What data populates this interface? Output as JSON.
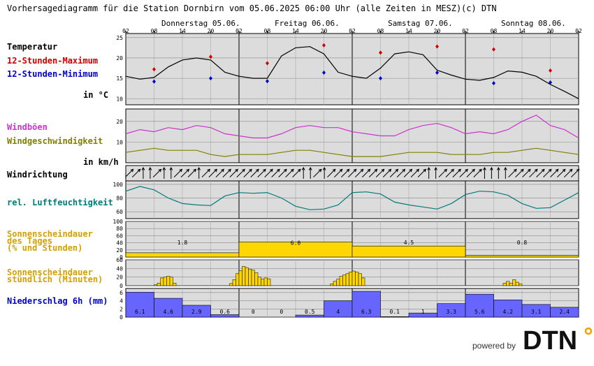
{
  "header": {
    "title": "Vorhersagediagramm für die Station Dornbirn vom 05.06.2025 06:00 Uhr (alle Zeiten in MESZ)",
    "copyright": "(c) DTN"
  },
  "days": [
    "Donnerstag 05.06.",
    "Freitag 06.06.",
    "Samstag 07.06.",
    "Sonntag 08.06."
  ],
  "hour_ticks": [
    "02",
    "08",
    "14",
    "20",
    "02",
    "08",
    "14",
    "20",
    "02",
    "08",
    "14",
    "20",
    "02",
    "08",
    "14",
    "20",
    "02"
  ],
  "labels": {
    "temperatur": "Temperatur",
    "max": "12-Stunden-Maximum",
    "min": "12-Stunden-Minimum",
    "temp_unit": "in °C",
    "windboeen": "Windböen",
    "windgeschw": "Windgeschwindigkeit",
    "wind_unit": "in km/h",
    "windrichtung": "Windrichtung",
    "feuchte": "rel. Luftfeuchtigkeit",
    "sonne_tag_1": "Sonnenscheindauer",
    "sonne_tag_2": "des Tages",
    "sonne_tag_3": "(% und Stunden)",
    "sonne_std_1": "Sonnenscheindauer",
    "sonne_std_2": "stündlich (Minuten)",
    "niederschlag": "Niederschlag 6h (mm)"
  },
  "footer": {
    "powered_by": "powered by",
    "logo_text": "DTN"
  },
  "colors": {
    "panel_bg": "#dcdcdc",
    "max": "#cc0000",
    "min": "#0000cc",
    "gusts": "#cc33cc",
    "wind": "#808000",
    "humidity": "#007b7b",
    "sun_label": "#d4a000",
    "sun_fill": "#ffd700",
    "rain_label": "#0000cc",
    "rain_fill": "#6666ff"
  },
  "chart_data": [
    {
      "panel": "temperature",
      "type": "line",
      "yticks": [
        10,
        15,
        20,
        25
      ],
      "ylim": [
        8.5,
        26
      ],
      "hours_from_start": [
        0,
        3,
        6,
        9,
        12,
        15,
        18,
        21,
        24,
        27,
        30,
        33,
        36,
        39,
        42,
        45,
        48,
        51,
        54,
        57,
        60,
        63,
        66,
        69,
        72,
        75,
        78,
        81,
        84,
        87,
        90,
        93,
        96
      ],
      "temperature": [
        15.5,
        14.8,
        15.2,
        17.8,
        19.5,
        20.0,
        19.5,
        16.5,
        15.5,
        15.0,
        15.0,
        20.5,
        22.5,
        22.8,
        21.0,
        16.5,
        15.5,
        15.0,
        17.5,
        21.0,
        21.5,
        20.8,
        17.0,
        15.8,
        14.8,
        14.5,
        15.2,
        16.8,
        16.5,
        15.5,
        13.5,
        11.8,
        10.0
      ],
      "max_points": [
        {
          "hour": 6,
          "value": 17.2
        },
        {
          "hour": 18,
          "value": 20.3
        },
        {
          "hour": 30,
          "value": 18.7
        },
        {
          "hour": 42,
          "value": 23.1
        },
        {
          "hour": 54,
          "value": 21.3
        },
        {
          "hour": 66,
          "value": 22.8
        },
        {
          "hour": 78,
          "value": 22.1
        },
        {
          "hour": 90,
          "value": 16.9
        }
      ],
      "min_points": [
        {
          "hour": 6,
          "value": 14.2
        },
        {
          "hour": 18,
          "value": 15.0
        },
        {
          "hour": 30,
          "value": 14.3
        },
        {
          "hour": 42,
          "value": 16.4
        },
        {
          "hour": 54,
          "value": 15.0
        },
        {
          "hour": 66,
          "value": 16.4
        },
        {
          "hour": 78,
          "value": 13.8
        },
        {
          "hour": 90,
          "value": 14.0
        }
      ]
    },
    {
      "panel": "wind",
      "type": "line",
      "yticks": [
        10,
        20
      ],
      "ylim": [
        0,
        26
      ],
      "hours_from_start": [
        0,
        3,
        6,
        9,
        12,
        15,
        18,
        21,
        24,
        27,
        30,
        33,
        36,
        39,
        42,
        45,
        48,
        51,
        54,
        57,
        60,
        63,
        66,
        69,
        72,
        75,
        78,
        81,
        84,
        87,
        90,
        93,
        96
      ],
      "series": [
        {
          "name": "Windböen",
          "values": [
            14,
            16,
            15,
            17,
            16,
            18,
            17,
            14,
            13,
            12,
            12,
            14,
            17,
            18,
            17,
            17,
            15,
            14,
            13,
            13,
            16,
            18,
            19,
            17,
            14,
            15,
            14,
            16,
            20,
            23,
            18,
            16,
            12
          ]
        },
        {
          "name": "Windgeschwindigkeit",
          "values": [
            5,
            6,
            7,
            6,
            6,
            6,
            4,
            3,
            4,
            4,
            4,
            5,
            6,
            6,
            5,
            4,
            3,
            3,
            3,
            4,
            5,
            5,
            5,
            4,
            4,
            4,
            5,
            5,
            6,
            7,
            6,
            5,
            4
          ]
        }
      ]
    },
    {
      "panel": "wind_direction",
      "type": "table",
      "direction_deg": [
        315,
        315,
        0,
        0,
        315,
        0,
        0,
        315,
        315,
        315,
        0,
        315,
        315,
        315,
        315,
        315,
        315,
        315,
        315,
        315,
        315,
        315,
        315,
        315,
        315,
        0,
        0,
        315,
        0,
        315,
        315,
        315,
        315,
        315,
        315,
        315,
        315,
        315,
        315,
        315,
        315,
        315,
        315,
        0,
        0,
        315,
        315,
        315,
        315,
        315,
        315,
        0,
        0,
        0,
        0,
        315,
        315,
        315,
        315,
        315,
        315,
        315,
        315,
        315,
        315
      ]
    },
    {
      "panel": "humidity",
      "type": "line",
      "yticks": [
        60,
        80,
        100
      ],
      "ylim": [
        50,
        105
      ],
      "hours_from_start": [
        0,
        3,
        6,
        9,
        12,
        15,
        18,
        21,
        24,
        27,
        30,
        33,
        36,
        39,
        42,
        45,
        48,
        51,
        54,
        57,
        60,
        63,
        66,
        69,
        72,
        75,
        78,
        81,
        84,
        87,
        90,
        93,
        96
      ],
      "values": [
        90,
        97,
        92,
        80,
        72,
        70,
        69,
        83,
        88,
        87,
        88,
        80,
        68,
        63,
        64,
        70,
        88,
        89,
        86,
        74,
        70,
        67,
        64,
        72,
        85,
        90,
        89,
        84,
        72,
        65,
        66,
        77,
        88
      ]
    },
    {
      "panel": "sunshine_daily",
      "type": "bar",
      "yticks": [
        0,
        20,
        40,
        60,
        80,
        100
      ],
      "ylim": [
        0,
        100
      ],
      "categories": [
        "Donnerstag 05.06.",
        "Freitag 06.06.",
        "Samstag 07.06.",
        "Sonntag 08.06."
      ],
      "percent": [
        12,
        42,
        31,
        5
      ],
      "hours_labels": [
        "1.8",
        "6.0",
        "4.5",
        "0.8"
      ]
    },
    {
      "panel": "sunshine_hourly",
      "type": "bar",
      "yticks": [
        0,
        20,
        40,
        60
      ],
      "ylim": [
        0,
        60
      ],
      "unit": "Minuten",
      "minutes": [
        0,
        0,
        0,
        0,
        0,
        0,
        0,
        0,
        0,
        2,
        6,
        18,
        20,
        22,
        20,
        6,
        0,
        0,
        0,
        0,
        0,
        0,
        0,
        0,
        0,
        0,
        0,
        0,
        0,
        0,
        0,
        0,
        0,
        5,
        14,
        28,
        35,
        45,
        42,
        38,
        36,
        30,
        20,
        15,
        18,
        16,
        0,
        0,
        0,
        0,
        0,
        0,
        0,
        0,
        0,
        0,
        0,
        0,
        0,
        0,
        0,
        0,
        0,
        0,
        0,
        4,
        10,
        15,
        22,
        25,
        28,
        32,
        34,
        32,
        28,
        18,
        0,
        0,
        0,
        0,
        0,
        0,
        0,
        0,
        0,
        0,
        0,
        0,
        0,
        0,
        0,
        0,
        0,
        0,
        0,
        0,
        0,
        0,
        0,
        0,
        0,
        0,
        0,
        0,
        0,
        0,
        0,
        0,
        0,
        0,
        0,
        0,
        0,
        0,
        0,
        0,
        0,
        0,
        0,
        0,
        6,
        10,
        6,
        14,
        8,
        4,
        0,
        0,
        0,
        0,
        0,
        0,
        0,
        0,
        0,
        0,
        0,
        0,
        0,
        0,
        0,
        0,
        0,
        0
      ]
    },
    {
      "panel": "precipitation",
      "type": "bar",
      "yticks": [
        0,
        2,
        4,
        6
      ],
      "ylim": [
        0,
        7
      ],
      "unit": "mm",
      "values": [
        6.1,
        4.6,
        2.9,
        0.6,
        0,
        0,
        0.5,
        4,
        6.3,
        0.1,
        1,
        3.3,
        5.6,
        4.2,
        3.1,
        2.4
      ],
      "labels": [
        "6.1",
        "4.6",
        "2.9",
        "0.6",
        "0",
        "0",
        "0.5",
        "4",
        "6.3",
        "0.1",
        "1",
        "3.3",
        "5.6",
        "4.2",
        "3.1",
        "2.4"
      ]
    }
  ]
}
